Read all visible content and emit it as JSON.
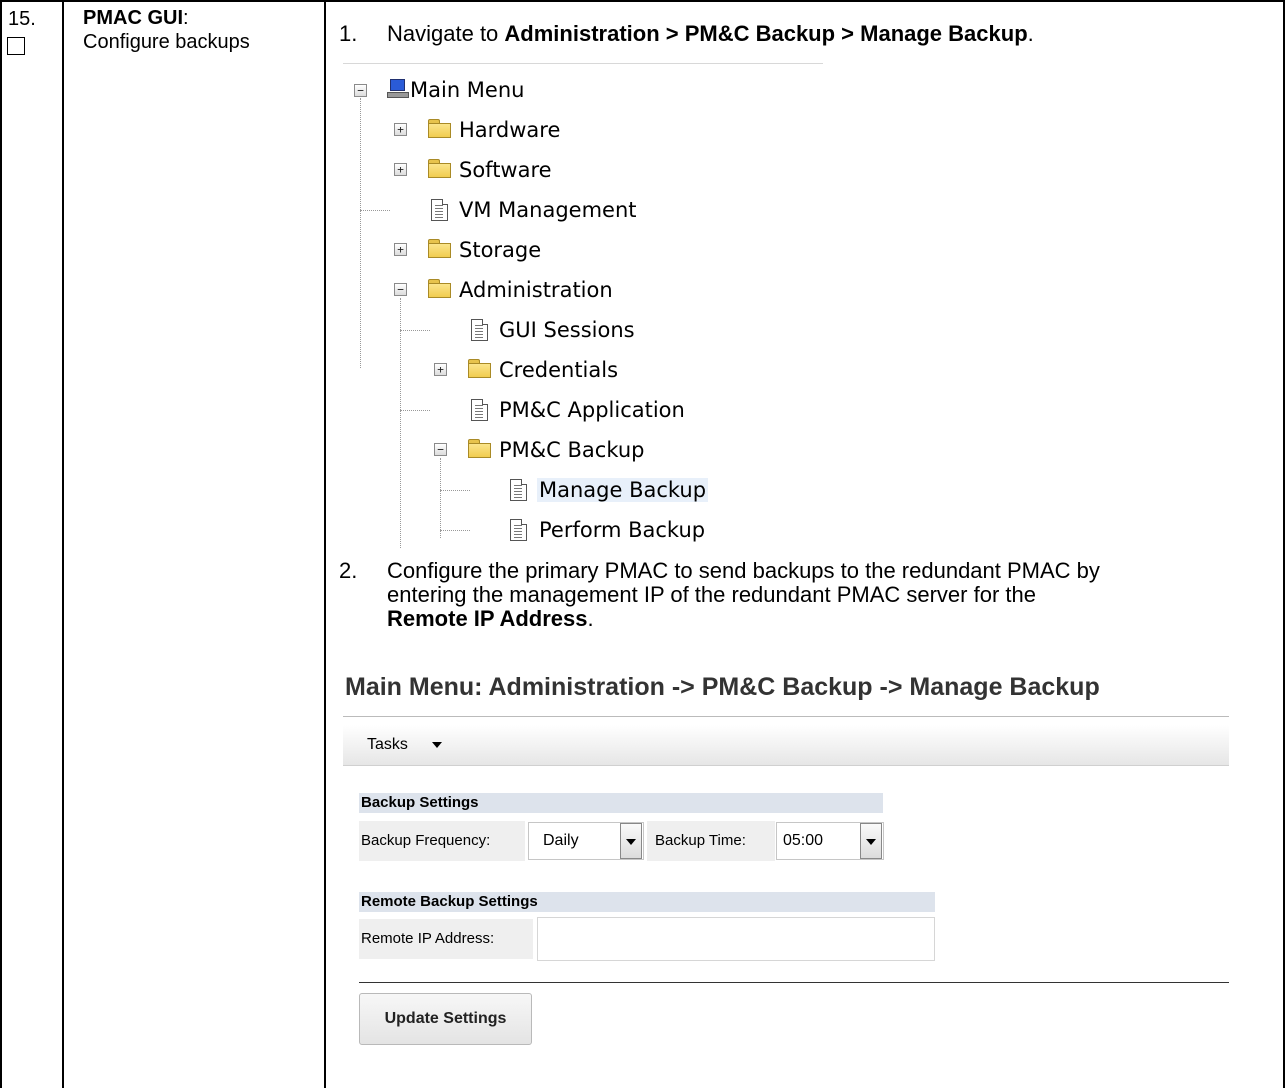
{
  "step": {
    "number": "15.",
    "title_bold": "PMAC GUI",
    "title_colon": ":",
    "subtitle": "Configure backups"
  },
  "instructions": {
    "one": {
      "num": "1.",
      "prefix": "Navigate to ",
      "path": "Administration > PM&C Backup > Manage Backup",
      "suffix": "."
    },
    "two": {
      "num": "2.",
      "line1": "Configure the primary PMAC to send backups to the redundant PMAC by",
      "line2": "entering the management IP of the redundant PMAC server for the",
      "bold": "Remote IP Address",
      "end": "."
    }
  },
  "tree": {
    "main_menu": "Main Menu",
    "hardware": "Hardware",
    "software": "Software",
    "vm_management": "VM Management",
    "storage": "Storage",
    "administration": "Administration",
    "gui_sessions": "GUI Sessions",
    "credentials": "Credentials",
    "pmc_application": "PM&C Application",
    "pmc_backup": "PM&C Backup",
    "manage_backup": "Manage Backup",
    "perform_backup": "Perform Backup",
    "expand_symbol": "+",
    "collapse_symbol": "−"
  },
  "page": {
    "heading": "Main Menu: Administration -> PM&C Backup -> Manage Backup",
    "tasks_label": "Tasks",
    "backup_settings": {
      "title": "Backup Settings",
      "frequency_label": "Backup Frequency:",
      "frequency_value": "Daily",
      "time_label": "Backup Time:",
      "time_value": "05:00"
    },
    "remote_settings": {
      "title": "Remote Backup Settings",
      "ip_label": "Remote IP Address:",
      "ip_value": ""
    },
    "update_button": "Update Settings"
  }
}
